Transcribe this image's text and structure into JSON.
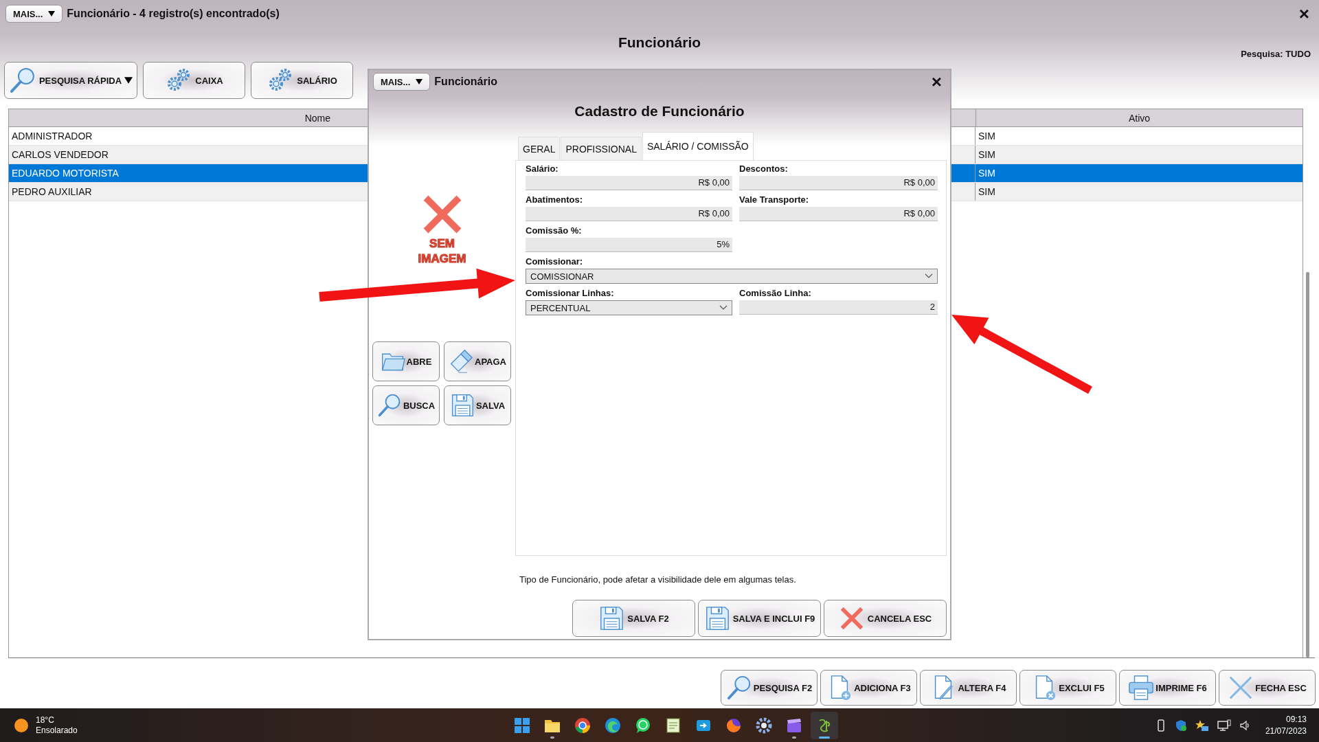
{
  "window": {
    "menu_button": "MAIS...",
    "title": "Funcionário - 4 registro(s) encontrado(s)",
    "close": "×"
  },
  "heading": "Funcionário",
  "search_scope": "Pesquisa: TUDO",
  "toolbar": [
    {
      "label": "PESQUISA RÁPIDA",
      "kind": "search",
      "dropdown": true
    },
    {
      "label": "CAIXA",
      "kind": "gears",
      "dropdown": false
    },
    {
      "label": "SALÁRIO",
      "kind": "gears",
      "dropdown": false
    }
  ],
  "table": {
    "columns": [
      "Nome",
      "Ativo"
    ],
    "rows": [
      {
        "cells": [
          "ADMINISTRADOR",
          "SIM"
        ],
        "selected": false
      },
      {
        "cells": [
          "CARLOS VENDEDOR",
          "SIM"
        ],
        "selected": false
      },
      {
        "cells": [
          "EDUARDO MOTORISTA",
          "SIM"
        ],
        "selected": true
      },
      {
        "cells": [
          "PEDRO AUXILIAR",
          "SIM"
        ],
        "selected": false
      }
    ]
  },
  "dialog": {
    "menu_button": "MAIS...",
    "title": "Funcionário",
    "close": "×",
    "heading": "Cadastro de Funcionário",
    "no_image": "SEM IMAGEM",
    "side_buttons": [
      {
        "label": "ABRE",
        "kind": "folder"
      },
      {
        "label": "APAGA",
        "kind": "eraser"
      },
      {
        "label": "BUSCA",
        "kind": "search"
      },
      {
        "label": "SALVA",
        "kind": "floppy"
      }
    ],
    "tabs": [
      {
        "label": "GERAL",
        "selected": false
      },
      {
        "label": "PROFISSIONAL",
        "selected": false
      },
      {
        "label": "SALÁRIO / COMISSÃO",
        "selected": true
      }
    ],
    "rows": [
      [
        {
          "label": "Salário:",
          "value": "R$ 0,00",
          "kind": "text"
        },
        {
          "label": "Descontos:",
          "value": "R$ 0,00",
          "kind": "text"
        }
      ],
      [
        {
          "label": "Abatimentos:",
          "value": "R$ 0,00",
          "kind": "text"
        },
        {
          "label": "Vale Transporte:",
          "value": "R$ 0,00",
          "kind": "text"
        }
      ],
      [
        {
          "label": "Comissão %:",
          "value": "5%",
          "kind": "text"
        }
      ],
      [
        {
          "label": "Comissionar:",
          "value": "COMISSIONAR",
          "kind": "select"
        }
      ],
      [
        {
          "label": "Comissionar Linhas:",
          "value": "PERCENTUAL",
          "kind": "select"
        },
        {
          "label": "Comissão Linha:",
          "value": "2",
          "kind": "text"
        }
      ]
    ],
    "note": "Tipo de Funcionário, pode afetar a visibilidade dele em algumas telas.",
    "footer_buttons": [
      {
        "label": "SALVA F2",
        "kind": "floppy"
      },
      {
        "label": "SALVA E INCLUI F9",
        "kind": "floppy"
      },
      {
        "label": "CANCELA ESC",
        "kind": "cross"
      }
    ]
  },
  "bottom_buttons": [
    {
      "label": "PESQUISA F2",
      "kind": "search"
    },
    {
      "label": "ADICIONA F3",
      "kind": "doc_plus"
    },
    {
      "label": "ALTERA F4",
      "kind": "doc_pencil"
    },
    {
      "label": "EXCLUI F5",
      "kind": "doc_x"
    },
    {
      "label": "IMPRIME F6",
      "kind": "printer"
    },
    {
      "label": "FECHA ESC",
      "kind": "thin_x"
    }
  ],
  "taskbar": {
    "weather": {
      "temperature": "18°C",
      "condition": "Ensolarado"
    },
    "apps": [
      {
        "kind": "start",
        "selected": false,
        "running": false
      },
      {
        "kind": "folder",
        "selected": false,
        "running": true
      },
      {
        "kind": "ring",
        "selected": false,
        "running": false
      },
      {
        "kind": "wave",
        "selected": false,
        "running": false
      },
      {
        "kind": "chat",
        "selected": false,
        "running": false
      },
      {
        "kind": "notepad",
        "selected": false,
        "running": false
      },
      {
        "kind": "arrowbox",
        "selected": false,
        "running": false
      },
      {
        "kind": "fox",
        "selected": false,
        "running": false
      },
      {
        "kind": "gear",
        "selected": false,
        "running": false
      },
      {
        "kind": "clapper",
        "selected": false,
        "running": true
      },
      {
        "kind": "applogo",
        "selected": true,
        "running": true
      }
    ],
    "time": "09:13",
    "date": "21/07/2023"
  }
}
